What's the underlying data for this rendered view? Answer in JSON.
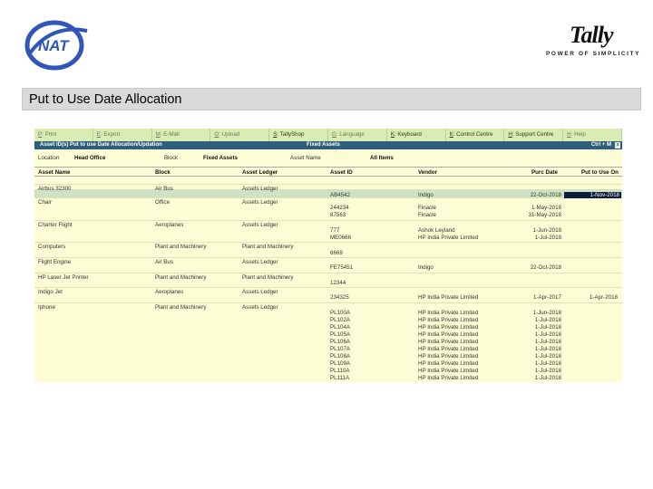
{
  "logos": {
    "nat_text": "NAT",
    "tally_text": "Tally",
    "tally_tagline": "POWER OF SIMPLICITY"
  },
  "slide_title": "Put to Use Date Allocation",
  "menu": [
    {
      "key": "P",
      "label": ": Print"
    },
    {
      "key": "E",
      "label": ": Export"
    },
    {
      "key": "M",
      "label": ": E-Mail"
    },
    {
      "key": "O",
      "label": ": Upload"
    },
    {
      "key": "S",
      "label": ": TallyShop"
    },
    {
      "key": "G",
      "label": ": Language"
    },
    {
      "key": "K",
      "label": ": Keyboard"
    },
    {
      "key": "K",
      "label": ": Control Centre"
    },
    {
      "key": "H",
      "label": ": Support Centre"
    },
    {
      "key": "H",
      "label": ": Help"
    }
  ],
  "window": {
    "title": "Asset ID(s) Put to use Date Allocation/Updation",
    "center": "Fixed Assets",
    "right": "Ctrl + M",
    "close": "x"
  },
  "filters": {
    "location_label": "Location",
    "location_value": "Head Office",
    "block_label": "Block",
    "block_value": "Fixed Assets",
    "asset_name_label": "Asset Name",
    "asset_name_value": "All Items"
  },
  "columns": [
    "Asset Name",
    "Block",
    "Asset Ledger",
    "Asset ID",
    "Vendor",
    "Purc Date",
    "Put to Use On"
  ],
  "groups": [
    {
      "name": "Airbus 32300",
      "block": "Air Bus",
      "ledger": "Assets Ledger"
    },
    {
      "name": "Chair",
      "block": "Office",
      "ledger": "Assets Ledger"
    },
    {
      "name": "Charter Flight",
      "block": "Aeroplanes",
      "ledger": "Assets Ledger"
    },
    {
      "name": "Computers",
      "block": "Plant and Machinery",
      "ledger": "Plant and Machinery"
    },
    {
      "name": "Flight Engine",
      "block": "Air Bus",
      "ledger": "Assets Ledger"
    },
    {
      "name": "HP Laser Jet Printer",
      "block": "Plant and Machinery",
      "ledger": "Plant and Machinery"
    },
    {
      "name": "Indigo Jet",
      "block": "Aeroplanes",
      "ledger": "Assets Ledger"
    },
    {
      "name": "Iphone",
      "block": "Plant and Machinery",
      "ledger": "Assets Ledger"
    }
  ],
  "items": [
    {
      "id": "AB4542",
      "vendor": "Indigo",
      "purc": "22-Oct-2018",
      "put": "1-Nov-2018",
      "selected": true
    },
    {
      "id": "244234",
      "vendor": "Finacle",
      "purc": "1-May-2018",
      "put": ""
    },
    {
      "id": "87563",
      "vendor": "Finacle",
      "purc": "31-May-2018",
      "put": ""
    },
    {
      "id": "777",
      "vendor": "Ashok Leyland",
      "purc": "1-Jun-2018",
      "put": ""
    },
    {
      "id": "ME0666",
      "vendor": "HP India Private Limited",
      "purc": "1-Jul-2018",
      "put": ""
    },
    {
      "id": "6669",
      "vendor": "",
      "purc": "",
      "put": ""
    },
    {
      "id": "FE75451",
      "vendor": "Indigo",
      "purc": "22-Oct-2018",
      "put": ""
    },
    {
      "id": "12344",
      "vendor": "",
      "purc": "",
      "put": ""
    },
    {
      "id": "234325",
      "vendor": "HP India Private Limited",
      "purc": "1-Apr-2017",
      "put": "1-Apr-2018"
    },
    {
      "id": "PL100A",
      "vendor": "HP India Private Limited",
      "purc": "1-Jun-2018",
      "put": ""
    },
    {
      "id": "PL102A",
      "vendor": "HP India Private Limited",
      "purc": "1-Jul-2018",
      "put": ""
    },
    {
      "id": "PL104A",
      "vendor": "HP India Private Limited",
      "purc": "1-Jul-2018",
      "put": ""
    },
    {
      "id": "PL105A",
      "vendor": "HP India Private Limited",
      "purc": "1-Jul-2018",
      "put": ""
    },
    {
      "id": "PL106A",
      "vendor": "HP India Private Limited",
      "purc": "1-Jul-2018",
      "put": ""
    },
    {
      "id": "PL107A",
      "vendor": "HP India Private Limited",
      "purc": "1-Jul-2018",
      "put": ""
    },
    {
      "id": "PL108A",
      "vendor": "HP India Private Limited",
      "purc": "1-Jul-2018",
      "put": ""
    },
    {
      "id": "PL109A",
      "vendor": "HP India Private Limited",
      "purc": "1-Jul-2018",
      "put": ""
    },
    {
      "id": "PL110A",
      "vendor": "HP India Private Limited",
      "purc": "1-Jul-2018",
      "put": ""
    },
    {
      "id": "PL111A",
      "vendor": "HP India Private Limited",
      "purc": "1-Jul-2018",
      "put": ""
    }
  ],
  "colors": {
    "menu_bg": "#d8ecb4",
    "title_bg": "#2d5f7c",
    "screen_bg": "#fdfdd5",
    "highlight": "#cfe3c4",
    "selected": "#0c1c3a"
  }
}
